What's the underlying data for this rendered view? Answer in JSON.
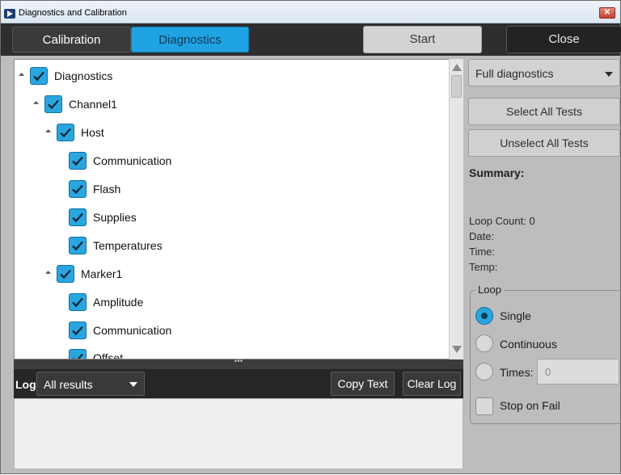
{
  "window": {
    "title": "Diagnostics and Calibration",
    "close_glyph": "✕"
  },
  "toolbar": {
    "tabs": [
      {
        "label": "Calibration",
        "active": false
      },
      {
        "label": "Diagnostics",
        "active": true
      }
    ],
    "start_label": "Start",
    "close_label": "Close"
  },
  "tree": {
    "items": [
      {
        "label": "Diagnostics",
        "checked": true,
        "expandable": true
      },
      {
        "label": "Channel1",
        "checked": true,
        "expandable": true
      },
      {
        "label": "Host",
        "checked": true,
        "expandable": true
      },
      {
        "label": "Communication",
        "checked": true,
        "expandable": false
      },
      {
        "label": "Flash",
        "checked": true,
        "expandable": false
      },
      {
        "label": "Supplies",
        "checked": true,
        "expandable": false
      },
      {
        "label": "Temperatures",
        "checked": true,
        "expandable": false
      },
      {
        "label": "Marker1",
        "checked": true,
        "expandable": true
      },
      {
        "label": "Amplitude",
        "checked": true,
        "expandable": false
      },
      {
        "label": "Communication",
        "checked": true,
        "expandable": false
      },
      {
        "label": "Offset",
        "checked": true,
        "expandable": false
      }
    ]
  },
  "splitter": {
    "grip": "•••"
  },
  "log": {
    "label": "Log",
    "filter_value": "All results",
    "copy_label": "Copy Text",
    "clear_label": "Clear Log"
  },
  "side": {
    "mode_value": "Full diagnostics",
    "select_all_label": "Select All Tests",
    "unselect_all_label": "Unselect All Tests",
    "summary_title": "Summary:",
    "loop_count": "Loop Count: 0",
    "date": "Date:",
    "time": "Time:",
    "temp": "Temp:",
    "loop": {
      "legend": "Loop",
      "options": [
        {
          "label": "Single",
          "selected": true
        },
        {
          "label": "Continuous",
          "selected": false
        },
        {
          "label": "Times:",
          "selected": false
        }
      ],
      "times_placeholder": "0",
      "stop_on_fail_label": "Stop on Fail",
      "stop_on_fail_checked": false
    }
  },
  "colors": {
    "accent": "#2aa6df",
    "toolbar_bg": "#2e2e2e",
    "panel_bg": "#bdbdbd"
  }
}
